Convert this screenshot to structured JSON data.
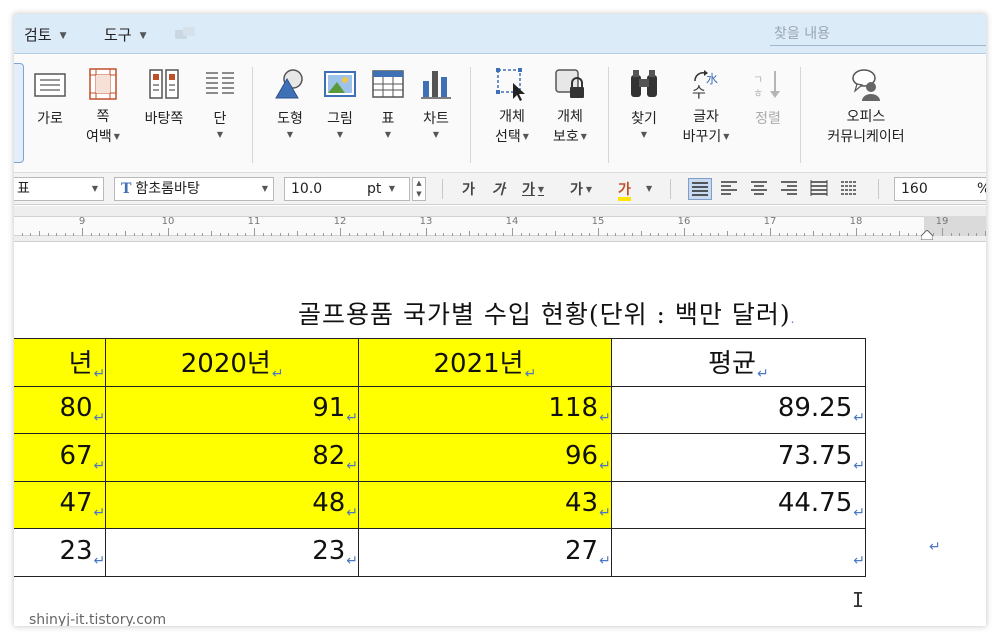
{
  "menubar": {
    "review": "검토",
    "tools": "도구",
    "search_placeholder": "찾을 내용"
  },
  "ribbon": {
    "buttons": [
      {
        "label": "가로",
        "icon": "landscape-page-icon",
        "has_dropdown": false
      },
      {
        "label": "쪽",
        "label2": "여백",
        "icon": "page-margin-icon",
        "has_dropdown": true
      },
      {
        "label": "바탕쪽",
        "icon": "master-page-icon",
        "has_dropdown": false
      },
      {
        "label": "단",
        "icon": "columns-icon",
        "has_dropdown": true
      },
      {
        "label": "도형",
        "icon": "shape-icon",
        "has_dropdown": true
      },
      {
        "label": "그림",
        "icon": "picture-icon",
        "has_dropdown": true
      },
      {
        "label": "표",
        "icon": "table-icon",
        "has_dropdown": true
      },
      {
        "label": "차트",
        "icon": "chart-icon",
        "has_dropdown": true
      },
      {
        "label": "개체",
        "label2": "선택",
        "icon": "select-object-icon",
        "has_dropdown": true
      },
      {
        "label": "개체",
        "label2": "보호",
        "icon": "protect-object-icon",
        "has_dropdown": true
      },
      {
        "label": "찾기",
        "icon": "binoculars-icon",
        "has_dropdown": true
      },
      {
        "label": "글자",
        "label2": "바꾸기",
        "icon": "replace-case-icon",
        "has_dropdown": true
      },
      {
        "label": "정렬",
        "icon": "sort-icon",
        "has_dropdown": false,
        "disabled": true
      },
      {
        "label": "오피스",
        "label2": "커뮤니케이터",
        "icon": "office-communicator-icon",
        "has_dropdown": false
      }
    ]
  },
  "format_bar": {
    "style_value": "표",
    "font_value": "함초롬바탕",
    "font_icon_letter": "T",
    "size_value": "10.0",
    "size_unit": "pt",
    "bold": "가",
    "italic": "가",
    "underline": "가",
    "strike": "가",
    "color": "가",
    "zoom_value": "160",
    "zoom_unit": "%"
  },
  "ruler": {
    "numbers": [
      "9",
      "10",
      "11",
      "12",
      "13",
      "14",
      "15",
      "16",
      "17",
      "18",
      "19"
    ]
  },
  "document": {
    "title": "골프용품 국가별 수입 현황(단위 : 백만 달러)",
    "table": {
      "headers": [
        "년",
        "2020년",
        "2021년",
        "평균"
      ],
      "rows": [
        [
          "80",
          "91",
          "118",
          "89.25"
        ],
        [
          "67",
          "82",
          "96",
          "73.75"
        ],
        [
          "47",
          "48",
          "43",
          "44.75"
        ],
        [
          "23",
          "23",
          "27",
          ""
        ]
      ]
    },
    "highlight_color": "#ffff00"
  },
  "watermark": "shinyj-it.tistory.com"
}
